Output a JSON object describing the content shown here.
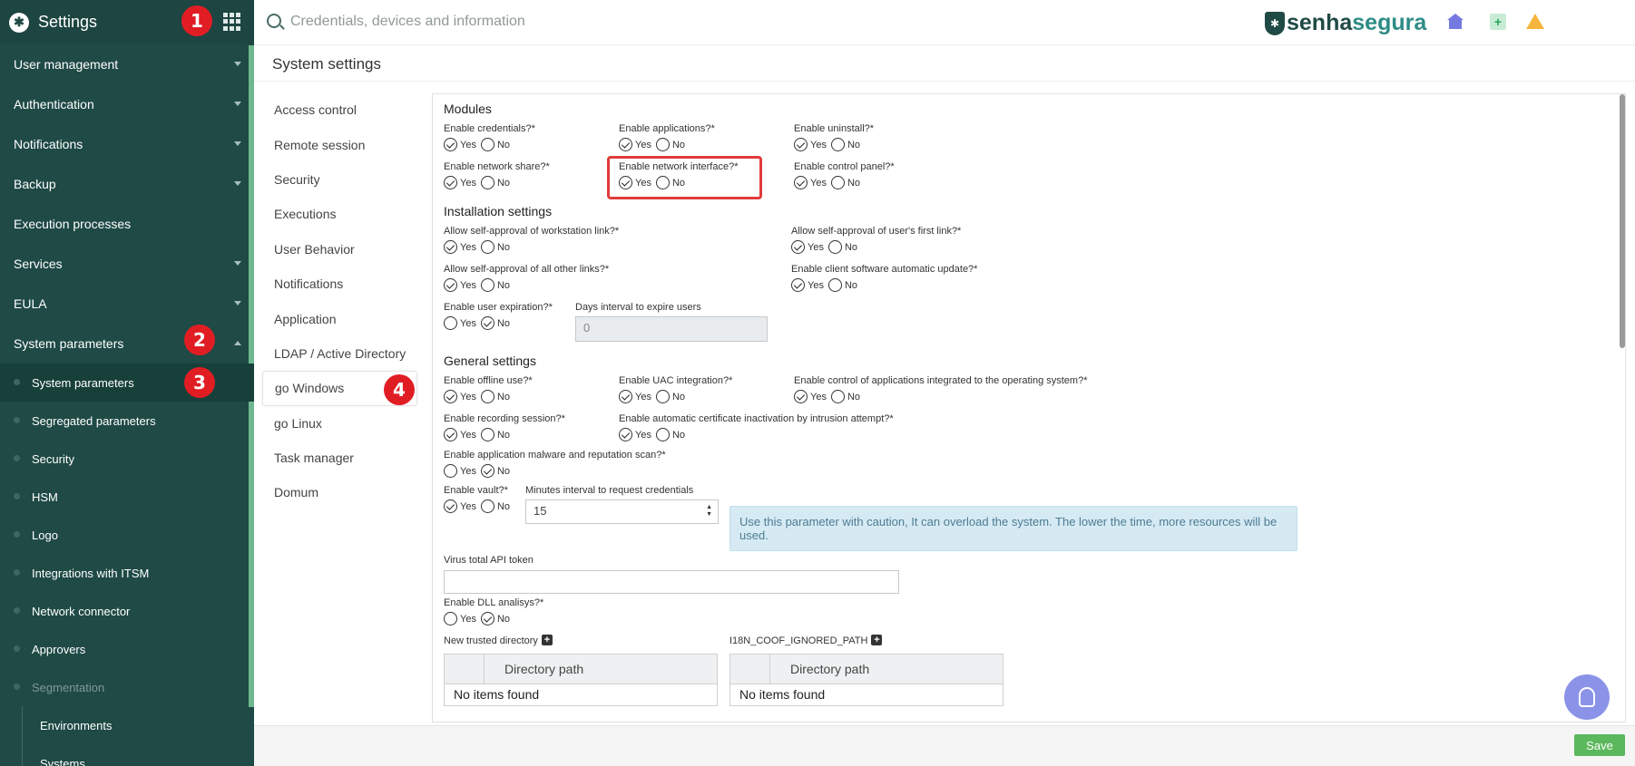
{
  "sidebar": {
    "app_title": "Settings",
    "logo_glyph": "✱",
    "items": [
      {
        "label": "User management"
      },
      {
        "label": "Authentication"
      },
      {
        "label": "Notifications"
      },
      {
        "label": "Backup"
      },
      {
        "label": "Execution processes"
      },
      {
        "label": "Services"
      },
      {
        "label": "EULA"
      },
      {
        "label": "System parameters"
      }
    ],
    "sub_items": [
      {
        "label": "System parameters"
      },
      {
        "label": "Segregated parameters"
      },
      {
        "label": "Security"
      },
      {
        "label": "HSM"
      },
      {
        "label": "Logo"
      },
      {
        "label": "Integrations with ITSM"
      },
      {
        "label": "Network connector"
      },
      {
        "label": "Approvers"
      },
      {
        "label": "Segmentation"
      }
    ],
    "sub_sub_items": [
      {
        "label": "Environments"
      },
      {
        "label": "Systems"
      }
    ]
  },
  "markers": [
    "1",
    "2",
    "3",
    "4"
  ],
  "header": {
    "search_placeholder": "Credentials, devices and information",
    "brand_part1": "senha",
    "brand_part2": "segura",
    "brand_glyph": "✱",
    "add_glyph": "+",
    "accent_color": "#1f4a45"
  },
  "page": {
    "title": "System settings"
  },
  "submenu": [
    "Access control",
    "Remote session",
    "Security",
    "Executions",
    "User Behavior",
    "Notifications",
    "Application",
    "LDAP / Active Directory",
    "go Windows",
    "go Linux",
    "Task manager",
    "Domum"
  ],
  "content": {
    "modules_title": "Modules",
    "installation_title": "Installation settings",
    "general_title": "General settings",
    "yes": "Yes",
    "no": "No",
    "fields": {
      "enable_credentials": "Enable credentials?*",
      "enable_applications": "Enable applications?*",
      "enable_uninstall": "Enable uninstall?*",
      "enable_network_share": "Enable network share?*",
      "enable_network_interface": "Enable network interface?*",
      "enable_control_panel": "Enable control panel?*",
      "allow_workstation_link": "Allow self-approval of workstation link?*",
      "allow_first_link": "Allow self-approval of user's first link?*",
      "allow_other_links": "Allow self-approval of all other links?*",
      "enable_client_update": "Enable client software automatic update?*",
      "enable_user_expiration": "Enable user expiration?*",
      "days_interval": "Days interval to expire users",
      "days_interval_value": "0",
      "enable_offline_use": "Enable offline use?*",
      "enable_uac": "Enable UAC integration?*",
      "enable_control_apps_os": "Enable control of applications integrated to the operating system?*",
      "enable_recording": "Enable recording session?*",
      "enable_cert_inactivation": "Enable automatic certificate inactivation by intrusion attempt?*",
      "enable_malware_scan": "Enable application malware and reputation scan?*",
      "enable_vault": "Enable vault?*",
      "minutes_interval": "Minutes interval to request credentials",
      "minutes_interval_value": "15",
      "virus_total_token": "Virus total API token",
      "virus_total_value": "",
      "enable_dll": "Enable DLL analisys?*",
      "new_trusted_directory": "New trusted directory",
      "coof_ignored_path": "I18N_COOF_IGNORED_PATH"
    },
    "info_message": "Use this parameter with caution, It can overload the system. The lower the time, more resources will be used.",
    "table_header": "Directory path",
    "table_empty": "No items found"
  },
  "footer": {
    "save_label": "Save"
  }
}
